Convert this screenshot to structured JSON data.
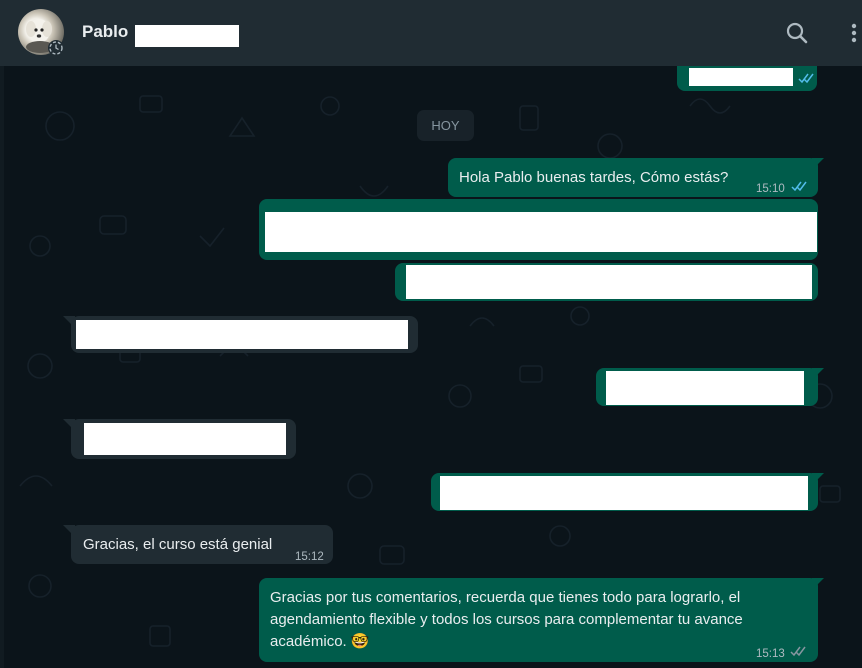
{
  "header": {
    "contact_name": "Pablo",
    "avatar_icon": "dog-avatar-icon",
    "search_icon": "search-icon",
    "menu_icon": "more-vertical-icon"
  },
  "chat": {
    "day_label": "HOY",
    "messages": [
      {
        "direction": "out",
        "text": "Hola Pablo buenas tardes, Cómo estás?",
        "time": "15:10",
        "status": "read"
      },
      {
        "direction": "in",
        "text": "Gracias, el curso está genial",
        "time": "15:12"
      },
      {
        "direction": "out",
        "text": "Gracias por tus comentarios, recuerda que tienes todo para lograrlo, el agendamiento flexible y todos los cursos para complementar tu avance académico. 🤓",
        "time": "15:13",
        "status": "read"
      }
    ]
  },
  "colors": {
    "outgoing_bubble": "#005c4b",
    "incoming_bubble": "#202c33",
    "header": "#202c33",
    "background": "#0b141a",
    "read_ticks": "#53bdeb"
  }
}
